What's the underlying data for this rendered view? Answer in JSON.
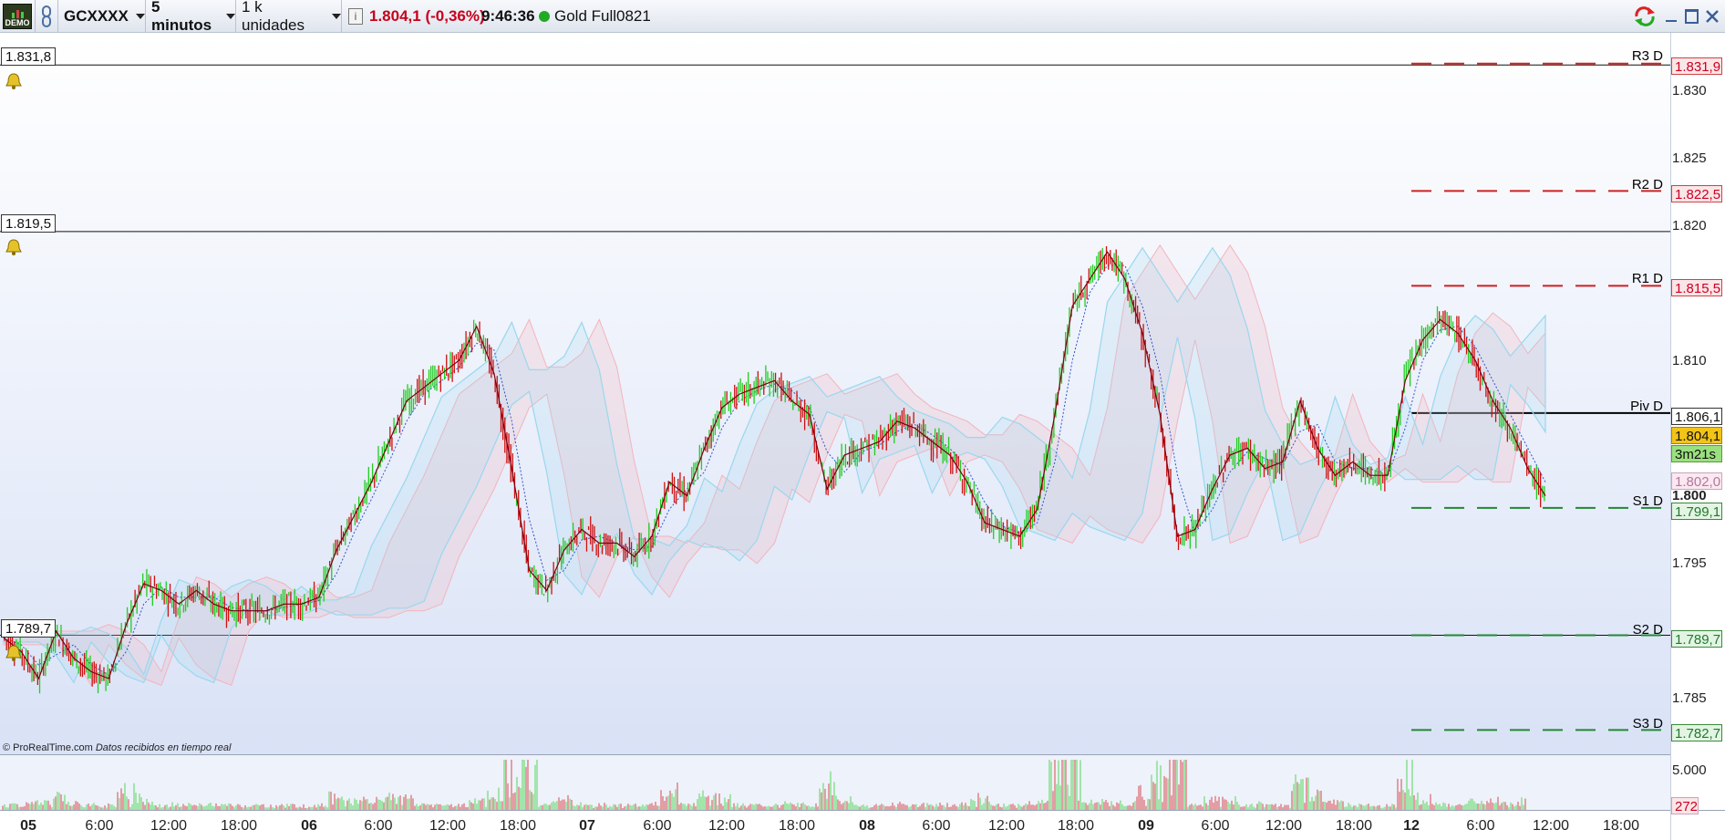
{
  "toolbar": {
    "demo_label": "DEMO",
    "instrument": "GCXXXX",
    "timeframe": "5 minutos",
    "units": "1 k unidades",
    "price_change": "1.804,1 (-0,36%)",
    "time": "9:46:36",
    "product": "Gold Full0821",
    "status_color": "#22aa22"
  },
  "alarms": [
    {
      "label": "1.831,8"
    },
    {
      "label": "1.819,5"
    },
    {
      "label": "1.789,7"
    }
  ],
  "pivots": [
    {
      "name": "R3 D",
      "value": "1.831,9",
      "color": "#cc2222"
    },
    {
      "name": "R2 D",
      "value": "1.822,5",
      "color": "#cc2222"
    },
    {
      "name": "R1 D",
      "value": "1.815,5",
      "color": "#cc2222"
    },
    {
      "name": "Piv D",
      "value": "1.806,1",
      "color": "#000000"
    },
    {
      "name": "S1 D",
      "value": "1.799,1",
      "color": "#228833"
    },
    {
      "name": "S2 D",
      "value": "1.789,7",
      "color": "#228833"
    },
    {
      "name": "S3 D",
      "value": "1.782,7",
      "color": "#228833"
    }
  ],
  "y_axis": {
    "ticks": [
      "1.830",
      "1.825",
      "1.820",
      "1.810",
      "1.800",
      "1.795",
      "1.785"
    ],
    "tick_values": [
      1830,
      1825,
      1820,
      1810,
      1800,
      1795,
      1785
    ],
    "current_price": "1.804,1",
    "countdown": "3m21s",
    "indicator_value": "1.802,0"
  },
  "x_axis": {
    "labels": [
      "05",
      "6:00",
      "12:00",
      "18:00",
      "06",
      "6:00",
      "12:00",
      "18:00",
      "07",
      "6:00",
      "12:00",
      "18:00",
      "08",
      "6:00",
      "12:00",
      "18:00",
      "09",
      "6:00",
      "12:00",
      "18:00",
      "12",
      "6:00",
      "12:00",
      "18:00"
    ],
    "day_labels": [
      "05",
      "06",
      "07",
      "08",
      "09",
      "12"
    ]
  },
  "volume": {
    "axis_label": "5.000",
    "current": "272"
  },
  "credit": {
    "source": "© ProRealTime.com",
    "note": "Datos recibidos en tiempo real"
  },
  "colors": {
    "price_up": "#22cc22",
    "price_down": "#cc1111",
    "close_line": "#7a0010",
    "cloud_a": "#9ad7ee",
    "cloud_b": "#f3b4bc",
    "tenkan": "#3355cc"
  },
  "chart_data": {
    "type": "line",
    "title": "",
    "ylim": [
      1781.5,
      1834
    ],
    "x_sessions": [
      "05",
      "06",
      "07",
      "08",
      "09",
      "12"
    ],
    "series": [
      {
        "name": "",
        "values": [
          1789.5,
          1788.5,
          1786.5,
          1790,
          1788,
          1787,
          1786.5,
          1790.5,
          1793.5,
          1793,
          1792,
          1793,
          1792,
          1791.5,
          1791.5,
          1791.5,
          1792,
          1792,
          1792.5,
          1796,
          1798.5,
          1801,
          1804,
          1807,
          1808,
          1809,
          1810,
          1812.5,
          1809,
          1802,
          1794.5,
          1793,
          1796,
          1797.5,
          1796.5,
          1796.5,
          1795.5,
          1797,
          1801,
          1800,
          1803.5,
          1806.5,
          1807.5,
          1808,
          1808.5,
          1807,
          1806,
          1800.5,
          1803,
          1803.5,
          1804,
          1805.5,
          1805,
          1804,
          1803,
          1801,
          1798,
          1797.5,
          1797,
          1799,
          1806,
          1814,
          1816,
          1818,
          1816,
          1812,
          1806,
          1797,
          1797.5,
          1800.5,
          1803,
          1803.5,
          1802,
          1802.5,
          1807,
          1803.5,
          1801.5,
          1802.5,
          1801.5,
          1801.5,
          1808.5,
          1811.5,
          1813,
          1812,
          1810,
          1807,
          1805,
          1802,
          1800
        ]
      }
    ]
  }
}
